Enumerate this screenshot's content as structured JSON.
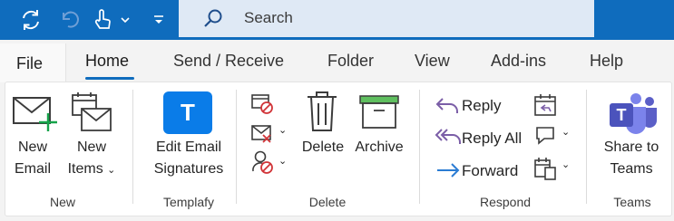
{
  "search": {
    "placeholder": "Search"
  },
  "tabs": {
    "file": "File",
    "home": "Home",
    "send_receive": "Send / Receive",
    "folder": "Folder",
    "view": "View",
    "addins": "Add-ins",
    "help": "Help"
  },
  "groups": {
    "new": {
      "label": "New",
      "new_email": [
        "New",
        "Email"
      ],
      "new_items": [
        "New",
        "Items"
      ]
    },
    "templafy": {
      "label": "Templafy",
      "edit_signatures": [
        "Edit Email",
        "Signatures"
      ],
      "logo_letter": "T"
    },
    "delete": {
      "label": "Delete",
      "delete": "Delete",
      "archive": "Archive"
    },
    "respond": {
      "label": "Respond",
      "reply": "Reply",
      "reply_all": "Reply All",
      "forward": "Forward"
    },
    "teams": {
      "label": "Teams",
      "share": [
        "Share to",
        "Teams"
      ],
      "logo_letter": "T"
    }
  },
  "colors": {
    "titlebar": "#0f6cbd",
    "accent": "#0f6cbd",
    "reply_purple": "#7b5ea7",
    "forward_blue": "#2b7cd3",
    "new_green": "#16a34a",
    "delete_red": "#d13438",
    "templafy_blue": "#0a7ce8",
    "teams_purple": "#5b5fc7"
  }
}
